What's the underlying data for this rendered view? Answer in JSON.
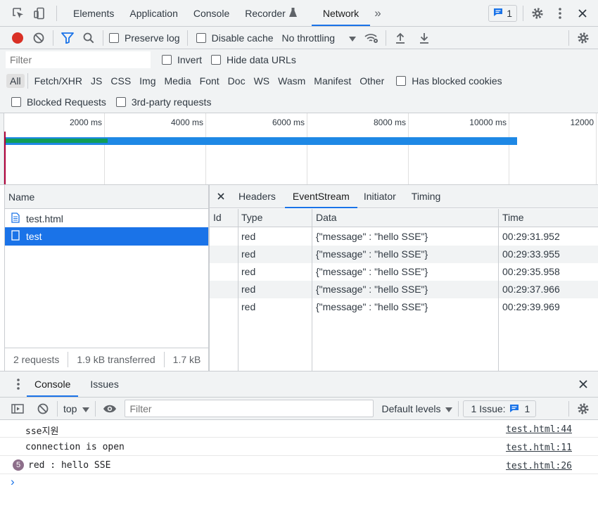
{
  "main_tabs": {
    "elements": "Elements",
    "application": "Application",
    "console": "Console",
    "recorder": "Recorder",
    "network": "Network",
    "issues_badge": "1"
  },
  "network_toolbar": {
    "preserve_log": "Preserve log",
    "disable_cache": "Disable cache",
    "throttling": "No throttling"
  },
  "filter_bar": {
    "placeholder": "Filter",
    "invert": "Invert",
    "hide_data_urls": "Hide data URLs"
  },
  "type_filters": {
    "all": "All",
    "fetch": "Fetch/XHR",
    "js": "JS",
    "css": "CSS",
    "img": "Img",
    "media": "Media",
    "font": "Font",
    "doc": "Doc",
    "ws": "WS",
    "wasm": "Wasm",
    "manifest": "Manifest",
    "other": "Other",
    "blocked_cookies": "Has blocked cookies"
  },
  "extra_filters": {
    "blocked_requests": "Blocked Requests",
    "third_party": "3rd-party requests"
  },
  "timeline": {
    "ticks": [
      "2000 ms",
      "4000 ms",
      "6000 ms",
      "8000 ms",
      "10000 ms",
      "12000"
    ]
  },
  "request_list": {
    "header": "Name",
    "items": [
      {
        "name": "test.html"
      },
      {
        "name": "test"
      }
    ],
    "status": {
      "requests": "2 requests",
      "transferred": "1.9 kB transferred",
      "resources": "1.7 kB"
    }
  },
  "detail_tabs": {
    "headers": "Headers",
    "eventstream": "EventStream",
    "initiator": "Initiator",
    "timing": "Timing"
  },
  "eventstream": {
    "columns": {
      "id": "Id",
      "type": "Type",
      "data": "Data",
      "time": "Time"
    },
    "rows": [
      {
        "id": "",
        "type": "red",
        "data": "{\"message\" : \"hello SSE\"}",
        "time": "00:29:31.952"
      },
      {
        "id": "",
        "type": "red",
        "data": "{\"message\" : \"hello SSE\"}",
        "time": "00:29:33.955"
      },
      {
        "id": "",
        "type": "red",
        "data": "{\"message\" : \"hello SSE\"}",
        "time": "00:29:35.958"
      },
      {
        "id": "",
        "type": "red",
        "data": "{\"message\" : \"hello SSE\"}",
        "time": "00:29:37.966"
      },
      {
        "id": "",
        "type": "red",
        "data": "{\"message\" : \"hello SSE\"}",
        "time": "00:29:39.969"
      }
    ]
  },
  "drawer": {
    "tab_console": "Console",
    "tab_issues": "Issues",
    "context": "top",
    "filter_placeholder": "Filter",
    "levels": "Default levels",
    "issues_label": "1 Issue:",
    "issues_count": "1"
  },
  "console_messages": [
    {
      "text": "sse지원",
      "source": "test.html:44",
      "count": ""
    },
    {
      "text": "connection is open",
      "source": "test.html:11",
      "count": ""
    },
    {
      "text": "red : hello SSE",
      "source": "test.html:26",
      "count": "5"
    }
  ],
  "prompt": "›",
  "colors": {
    "accent": "#1a73e8",
    "record_red": "#d93025",
    "selected_row": "#1a73e8",
    "timeline_green": "#0f9d58",
    "timeline_blue": "#1e88e5"
  }
}
